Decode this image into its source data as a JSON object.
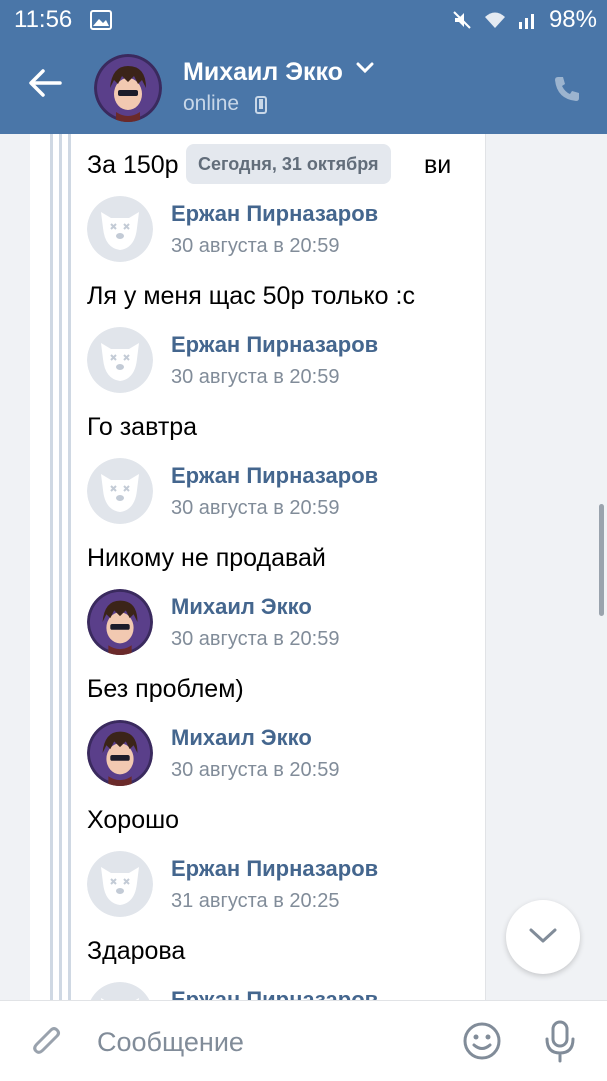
{
  "status_bar": {
    "time": "11:56",
    "battery": "98%"
  },
  "header": {
    "name": "Михаил Экко",
    "status": "online"
  },
  "date_pill": "Сегодня, 31 октября",
  "input": {
    "placeholder": "Сообщение"
  },
  "messages": [
    {
      "type": "text",
      "text": "За 150р",
      "tail": "ви"
    },
    {
      "type": "author",
      "avatar": "dog",
      "name": "Ержан Пирназаров",
      "date": "30 августа в 20:59"
    },
    {
      "type": "text",
      "text": "Ля у меня щас 50р только :с"
    },
    {
      "type": "author",
      "avatar": "dog",
      "name": "Ержан Пирназаров",
      "date": "30 августа в 20:59"
    },
    {
      "type": "text",
      "text": "Го завтра"
    },
    {
      "type": "author",
      "avatar": "dog",
      "name": "Ержан Пирназаров",
      "date": "30 августа в 20:59"
    },
    {
      "type": "text",
      "text": "Никому не продавай"
    },
    {
      "type": "author",
      "avatar": "photo",
      "name": "Михаил Экко",
      "date": "30 августа в 20:59"
    },
    {
      "type": "text",
      "text": "Без проблем)"
    },
    {
      "type": "author",
      "avatar": "photo",
      "name": "Михаил Экко",
      "date": "30 августа в 20:59"
    },
    {
      "type": "text",
      "text": "Хорошо"
    },
    {
      "type": "author",
      "avatar": "dog",
      "name": "Ержан Пирназаров",
      "date": "31 августа в 20:25"
    },
    {
      "type": "text",
      "text": "Здарова"
    },
    {
      "type": "author",
      "avatar": "dog",
      "name": "Ержан Пирназаров",
      "date": ""
    }
  ],
  "colors": {
    "brand": "#4a76a8",
    "author": "#44668e",
    "muted": "#818c99"
  },
  "icons": [
    "back-arrow-icon",
    "chevron-down-icon",
    "phone-icon",
    "call-icon",
    "attach-icon",
    "smile-icon",
    "mic-icon",
    "chevron-down-icon"
  ]
}
